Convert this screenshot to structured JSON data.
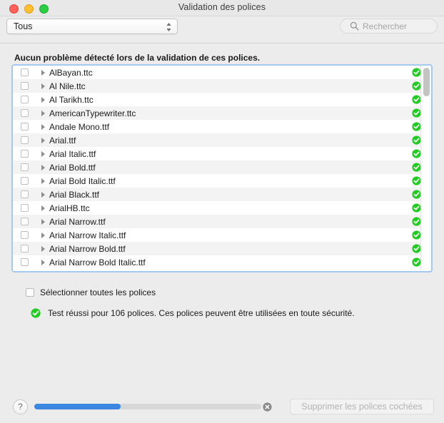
{
  "window": {
    "title": "Validation des polices",
    "traffic_lights": [
      "close-button",
      "minimize-button",
      "maximize-button"
    ]
  },
  "toolbar": {
    "filter_value": "Tous",
    "filter_icon": "chevron-up-down-icon",
    "search_placeholder": "Rechercher",
    "search_value": "",
    "search_icon": "search-icon"
  },
  "heading": "Aucun problème détecté lors de la validation de ces polices.",
  "font_list": {
    "scroll_thumb_position": "top",
    "rows": [
      {
        "name": "AlBayan.ttc",
        "checked": false,
        "status": "valid"
      },
      {
        "name": "Al Nile.ttc",
        "checked": false,
        "status": "valid"
      },
      {
        "name": "Al Tarikh.ttc",
        "checked": false,
        "status": "valid"
      },
      {
        "name": "AmericanTypewriter.ttc",
        "checked": false,
        "status": "valid"
      },
      {
        "name": "Andale Mono.ttf",
        "checked": false,
        "status": "valid"
      },
      {
        "name": "Arial.ttf",
        "checked": false,
        "status": "valid"
      },
      {
        "name": "Arial Italic.ttf",
        "checked": false,
        "status": "valid"
      },
      {
        "name": "Arial Bold.ttf",
        "checked": false,
        "status": "valid"
      },
      {
        "name": "Arial Bold Italic.ttf",
        "checked": false,
        "status": "valid"
      },
      {
        "name": "Arial Black.ttf",
        "checked": false,
        "status": "valid"
      },
      {
        "name": "ArialHB.ttc",
        "checked": false,
        "status": "valid"
      },
      {
        "name": "Arial Narrow.ttf",
        "checked": false,
        "status": "valid"
      },
      {
        "name": "Arial Narrow Italic.ttf",
        "checked": false,
        "status": "valid"
      },
      {
        "name": "Arial Narrow Bold.ttf",
        "checked": false,
        "status": "valid"
      },
      {
        "name": "Arial Narrow Bold Italic.ttf",
        "checked": false,
        "status": "valid"
      }
    ]
  },
  "select_all": {
    "label": "Sélectionner toutes les polices",
    "checked": false
  },
  "result": {
    "icon": "success-check-icon",
    "text": "Test réussi pour 106 polices. Ces polices peuvent être utilisées en toute sécurité."
  },
  "bottom_bar": {
    "help_label": "?",
    "progress_percent": 38,
    "stop_icon": "stop-cancel-icon",
    "delete_label": "Supprimer les polices cochées",
    "delete_enabled": false
  },
  "colors": {
    "accent_blue": "#3a86e0",
    "focus_ring": "#a3c9ef",
    "success_green": "#22cc22",
    "window_bg": "#ececec",
    "row_alt": "#f3f3f3"
  }
}
